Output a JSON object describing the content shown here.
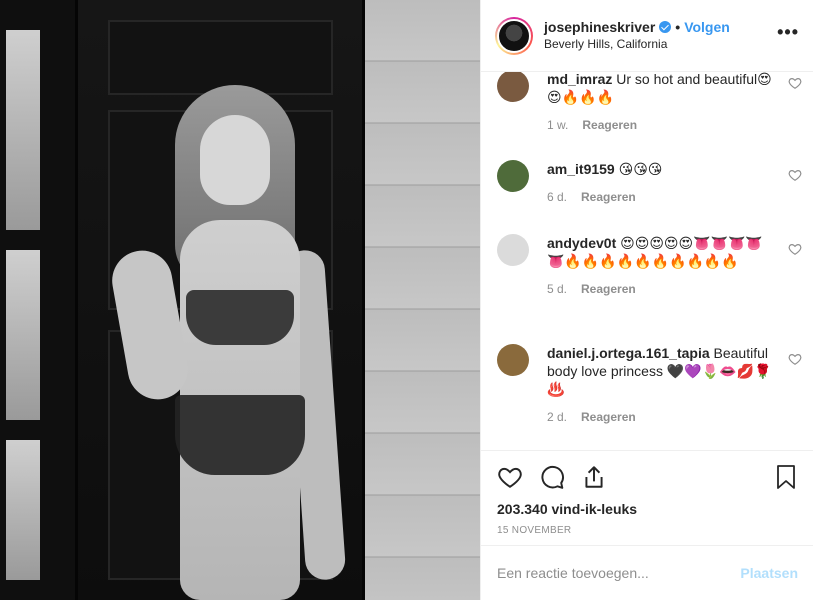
{
  "post": {
    "username": "josephineskriver",
    "separator": "•",
    "follow_label": "Volgen",
    "location": "Beverly Hills, California",
    "more_label": "•••"
  },
  "comments": [
    {
      "user": "md_imraz",
      "text": "Ur so hot and beautiful😍😍🔥🔥🔥",
      "time": "1 w.",
      "reply": "Reageren",
      "avatar_color": "#7a5a40"
    },
    {
      "user": "am_it9159",
      "text": "😘😘😘",
      "time": "6 d.",
      "reply": "Reageren",
      "avatar_color": "#4f6b3a"
    },
    {
      "user": "andydev0t",
      "text": "😍😍😍😍😍👅👅👅👅👅🔥🔥🔥🔥🔥🔥🔥🔥🔥🔥",
      "time": "5 d.",
      "reply": "Reageren",
      "avatar_color": "#dbdbdb"
    },
    {
      "user": "daniel.j.ortega.161_tapia",
      "text": "Beautiful body love princess 🖤💜🌷👄💋🌹♨️",
      "time": "2 d.",
      "reply": "Reageren",
      "avatar_color": "#8a6a3c"
    }
  ],
  "likes": "203.340 vind-ik-leuks",
  "date": "15 NOVEMBER",
  "comment_input": {
    "placeholder": "Een reactie toevoegen...",
    "value": ""
  },
  "post_button": "Plaatsen",
  "icons": [
    "heart-icon",
    "comment-icon",
    "share-icon",
    "bookmark-icon",
    "verified-icon",
    "more-icon"
  ],
  "colors": {
    "accent": "#3897f0",
    "post_button": "#b2dffc",
    "muted": "#8e8e8e",
    "border": "#efefef"
  }
}
